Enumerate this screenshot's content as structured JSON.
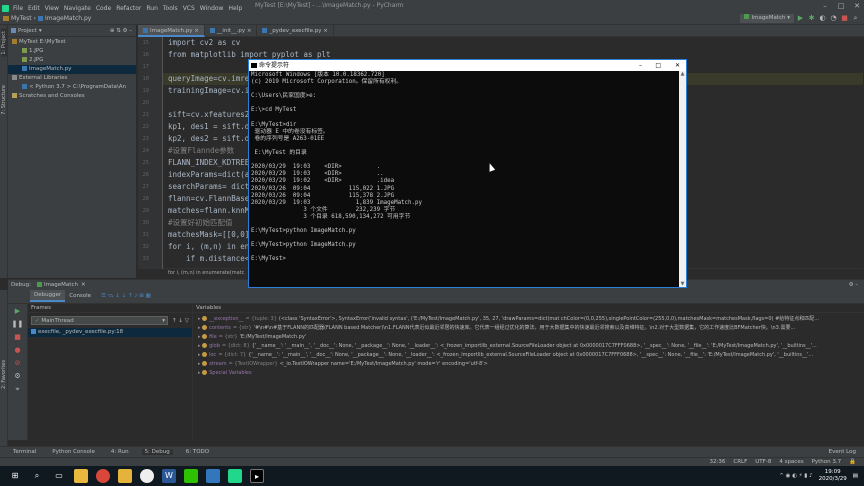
{
  "window": {
    "title": "MyTest [E:\\MyTest] - ...\\ImageMatch.py - PyCharm"
  },
  "menu": [
    "File",
    "Edit",
    "View",
    "Navigate",
    "Code",
    "Refactor",
    "Run",
    "Tools",
    "VCS",
    "Window",
    "Help"
  ],
  "nav": {
    "project": "MyTest",
    "file": "ImageMatch.py",
    "run_config": "ImageMatch"
  },
  "project_panel": {
    "title": "Project",
    "tree": [
      {
        "label": "MyTest  E:\\MyTest",
        "indent": 0,
        "icon": "folder"
      },
      {
        "label": "1.JPG",
        "indent": 1,
        "icon": "image"
      },
      {
        "label": "2.JPG",
        "indent": 1,
        "icon": "image"
      },
      {
        "label": "ImageMatch.py",
        "indent": 1,
        "icon": "python",
        "selected": true
      },
      {
        "label": "External Libraries",
        "indent": 0,
        "icon": "library"
      },
      {
        "label": "< Python 3.7 > C:\\ProgramData\\An",
        "indent": 1,
        "icon": "python"
      },
      {
        "label": "Scratches and Consoles",
        "indent": 0,
        "icon": "scratch"
      }
    ]
  },
  "tabs": [
    {
      "label": "ImageMatch.py",
      "active": true
    },
    {
      "label": "__init__.py",
      "active": false
    },
    {
      "label": "_pydev_execfile.py",
      "active": false
    }
  ],
  "editor": {
    "line_numbers": [
      "15",
      "16",
      "17",
      "18",
      "19",
      "20",
      "21",
      "22",
      "23",
      "24",
      "25",
      "26",
      "27",
      "28",
      "29",
      "30",
      "31",
      "32",
      "33"
    ],
    "lines": [
      "import cv2 as cv",
      "from matplotlib import pyplot as plt",
      "",
      "queryImage=cv.imre",
      "trainingImage=cv.i",
      "",
      "sift=cv.xfeatures2",
      "kp1, des1 = sift.d",
      "kp2, des2 = sift.d",
      "#设置Flannde参数",
      "FLANN_INDEX_KDTREE",
      "indexParams=dict(a",
      "searchParams= dict",
      "flann=cv.FlannBase",
      "matches=flann.knnM",
      "#设置好初始匹配值",
      "matchesMask=[[0,0]",
      "for i, (m,n) in en",
      "    if m.distance<"
    ],
    "breakpoint_line": "18",
    "breadcrumb": "for i, (m,n) in enumerate(matc"
  },
  "cmd": {
    "title": "命令提示符",
    "lines": [
      "Microsoft Windows [版本 10.0.18362.720]",
      "(c) 2019 Microsoft Corporation。保留所有权利。",
      "",
      "C:\\Users\\民家国度>e:",
      "",
      "E:\\>cd MyTest",
      "",
      "E:\\MyTest>dir",
      " 驱动器 E 中的卷没有标签。",
      " 卷的序列号是 A263-01EE",
      "",
      " E:\\MyTest 的目录",
      "",
      "2020/03/29  19:03    <DIR>          .",
      "2020/03/29  19:03    <DIR>          ..",
      "2020/03/29  19:02    <DIR>          .idea",
      "2020/03/26  09:04           115,022 1.JPG",
      "2020/03/26  09:04           115,378 2.JPG",
      "2020/03/29  19:03             1,839 ImageMatch.py",
      "               3 个文件        232,239 字节",
      "               3 个目录 618,590,134,272 可用字节",
      "",
      "E:\\MyTest>python ImageMatch.py",
      "",
      "E:\\MyTest>python ImageMatch.py",
      "",
      "E:\\MyTest>"
    ]
  },
  "debug": {
    "label": "Debug:",
    "config": "ImageMatch",
    "tabs": [
      "Debugger",
      "Console"
    ],
    "frames_title": "Frames",
    "thread": "MainThread",
    "frame": "execfile, _pydev_execfile.py:18",
    "variables_title": "Variables",
    "variables": [
      {
        "name": "__exception__",
        "type": "= {tuple: 3}",
        "value": "(<class 'SyntaxError'>, SyntaxError('invalid syntax', ('E:/MyTest/ImageMatch.py', 35, 27, 'drawParams=dict(mat chColor=(0,0,255),singlePointColor=(255,0,0),matchesMask=matchesMask,flags=0) #给特征点和匹配..."
      },
      {
        "name": "contents",
        "type": "= {str}",
        "value": "'#\\n#\\n#基于FLANN的匹配器(FLANN based Matcher)\\n1.FLANN代表近似最近邻居的快速库。它代表一组经过优化的算法，用于大数据集中的快速最近邻搜索以及高维特征。\\n2.对于大型数据集，它的工作速度比BFMatcher快。\\n3.需要..."
      },
      {
        "name": "file",
        "type": "= {str}",
        "value": "'E:/MyTest/ImageMatch.py'"
      },
      {
        "name": "glob",
        "type": "= {dict: 8}",
        "value": "{'__name__': '__main__', '__doc__': None, '__package__': None, '__loader__': <_frozen_importlib_external.SourceFileLoader object at 0x0000017C7FFF0688>, '__spec__': None, '__file__': 'E:/MyTest/ImageMatch.py', '__builtins__'..."
      },
      {
        "name": "loc",
        "type": "= {dict: 7}",
        "value": "{'__name__': '__main__', '__doc__': None, '__package__': None, '__loader__': <_frozen_importlib_external.SourceFileLoader object at 0x0000017C7FFF0688>, '__spec__': None, '__file__': 'E:/MyTest/ImageMatch.py', '__builtins__'..."
      },
      {
        "name": "stream",
        "type": "= {TextIOWrapper}",
        "value": "<_io.TextIOWrapper name='E:/MyTest/ImageMatch.py' mode='r' encoding='utf-8'>"
      },
      {
        "name": "Special Variables",
        "type": "",
        "value": ""
      }
    ]
  },
  "tool_tabs": [
    "Terminal",
    "Python Console",
    "4: Run",
    "5: Debug",
    "6: TODO"
  ],
  "event_log": "Event Log",
  "status": {
    "position": "32:36",
    "line_sep": "CRLF",
    "encoding": "UTF-8",
    "indent": "4 spaces",
    "interpreter": "Python 3.7"
  },
  "taskbar": {
    "time": "19:09",
    "date": "2020/3/29"
  },
  "side_tabs": {
    "project": "1: Project",
    "structure": "7: Structure",
    "favorites": "2: Favorites"
  }
}
